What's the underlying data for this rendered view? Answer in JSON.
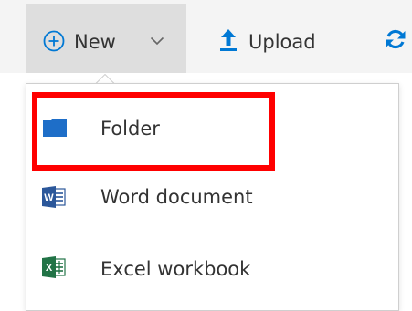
{
  "toolbar": {
    "new_label": "New",
    "new_icon": "plus-circle-icon",
    "new_chevron_icon": "chevron-down-icon",
    "upload_label": "Upload",
    "upload_icon": "upload-arrow-icon",
    "sync_icon": "sync-icon"
  },
  "menu": {
    "items": [
      {
        "label": "Folder",
        "icon": "folder-icon",
        "icon_color": "#1e6ec8"
      },
      {
        "label": "Word document",
        "icon": "word-icon",
        "icon_color": "#2b579a"
      },
      {
        "label": "Excel workbook",
        "icon": "excel-icon",
        "icon_color": "#217346"
      }
    ]
  },
  "annotation": {
    "highlight_color": "#ff0000",
    "highlighted_item": "Folder"
  },
  "colors": {
    "accent": "#0078d4",
    "toolbar_bg": "#f4f4f4",
    "new_button_active_bg": "#dedede"
  }
}
